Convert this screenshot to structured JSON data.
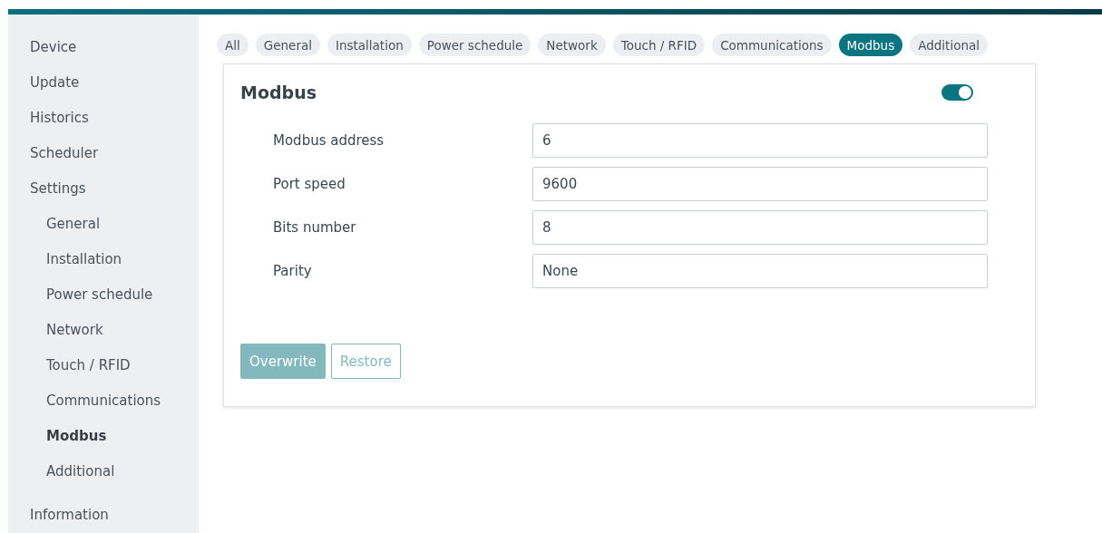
{
  "sidebar": {
    "items": [
      {
        "label": "Device",
        "selected": false
      },
      {
        "label": "Update",
        "selected": false
      },
      {
        "label": "Historics",
        "selected": false
      },
      {
        "label": "Scheduler",
        "selected": false
      },
      {
        "label": "Settings",
        "selected": false,
        "children": [
          {
            "label": "General",
            "selected": false
          },
          {
            "label": "Installation",
            "selected": false
          },
          {
            "label": "Power schedule",
            "selected": false
          },
          {
            "label": "Network",
            "selected": false
          },
          {
            "label": "Touch / RFID",
            "selected": false
          },
          {
            "label": "Communications",
            "selected": false
          },
          {
            "label": "Modbus",
            "selected": true
          },
          {
            "label": "Additional",
            "selected": false
          }
        ]
      },
      {
        "label": "Information",
        "selected": false
      }
    ]
  },
  "tabs": [
    {
      "label": "All",
      "selected": false
    },
    {
      "label": "General",
      "selected": false
    },
    {
      "label": "Installation",
      "selected": false
    },
    {
      "label": "Power schedule",
      "selected": false
    },
    {
      "label": "Network",
      "selected": false
    },
    {
      "label": "Touch / RFID",
      "selected": false
    },
    {
      "label": "Communications",
      "selected": false
    },
    {
      "label": "Modbus",
      "selected": true
    },
    {
      "label": "Additional",
      "selected": false
    }
  ],
  "card": {
    "title": "Modbus",
    "enabled": true,
    "fields": [
      {
        "label": "Modbus address",
        "value": "6"
      },
      {
        "label": "Port speed",
        "value": "9600"
      },
      {
        "label": "Bits number",
        "value": "8"
      },
      {
        "label": "Parity",
        "value": "None"
      }
    ],
    "buttons": [
      {
        "label": "Overwrite",
        "kind": "primary",
        "disabled": true
      },
      {
        "label": "Restore",
        "kind": "secondary",
        "disabled": true
      }
    ]
  }
}
